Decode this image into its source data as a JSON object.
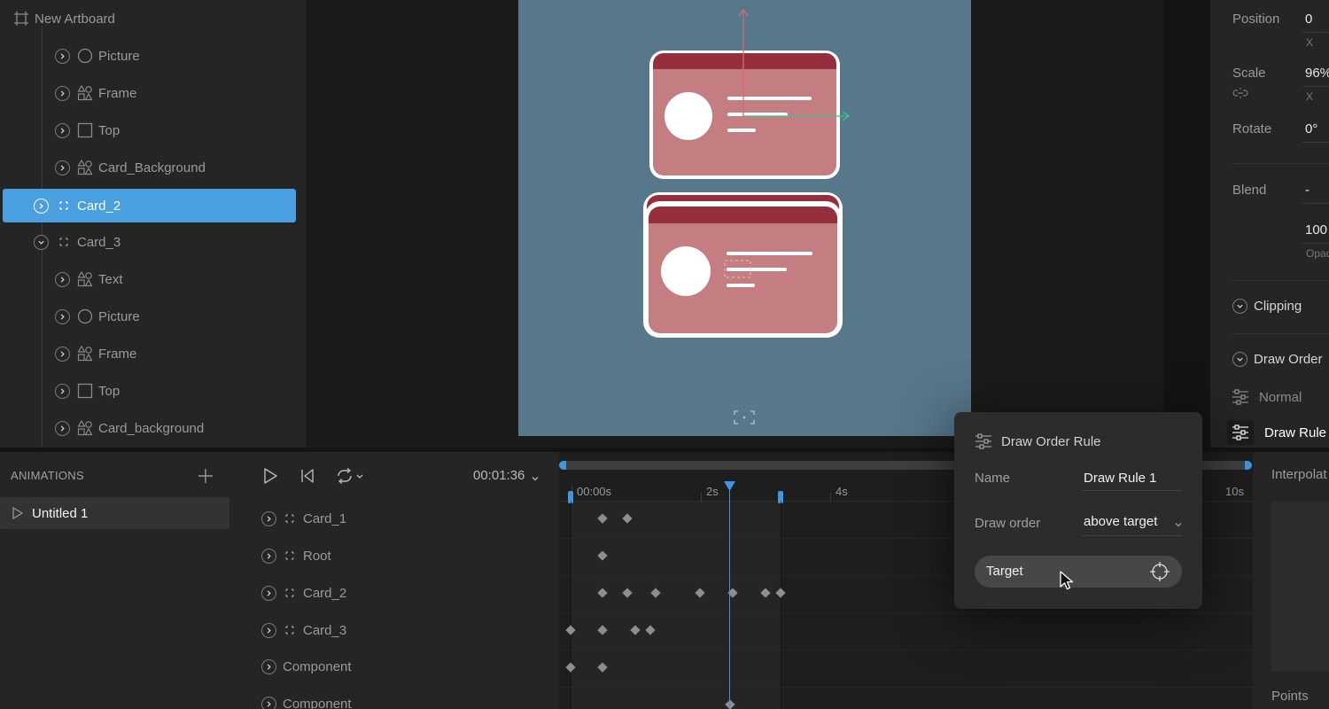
{
  "hierarchy": {
    "artboard_label": "New Artboard",
    "items": [
      {
        "label": "Picture",
        "icon": "ellipse-icon"
      },
      {
        "label": "Frame",
        "icon": "shapes-icon"
      },
      {
        "label": "Top",
        "icon": "rectangle-icon"
      },
      {
        "label": "Card_Background",
        "icon": "shapes-icon"
      },
      {
        "label": "Card_2",
        "icon": "group-icon",
        "selected": true
      },
      {
        "label": "Card_3",
        "icon": "group-icon",
        "expanded": true
      },
      {
        "label": "Text",
        "icon": "shapes-icon"
      },
      {
        "label": "Picture",
        "icon": "ellipse-icon"
      },
      {
        "label": "Frame",
        "icon": "shapes-icon"
      },
      {
        "label": "Top",
        "icon": "rectangle-icon"
      },
      {
        "label": "Card_background",
        "icon": "shapes-icon"
      }
    ]
  },
  "inspector": {
    "position_label": "Position",
    "position_value": "0",
    "position_sub": "X",
    "scale_label": "Scale",
    "scale_value": "96%",
    "scale_sub": "X",
    "rotate_label": "Rotate",
    "rotate_value": "0°",
    "blend_label": "Blend",
    "blend_value": "-",
    "opacity_value": "100",
    "opacity_sub": "Opac",
    "clipping_label": "Clipping",
    "draw_order_label": "Draw Order",
    "normal_label": "Normal",
    "draw_rule_label": "Draw Rule"
  },
  "animations": {
    "header": "ANIMATIONS",
    "items": [
      {
        "label": "Untitled 1"
      }
    ]
  },
  "timeline": {
    "current_time": "00:01:36",
    "ticks": [
      "00:00s",
      "2s",
      "4s",
      "10s"
    ],
    "layers": [
      {
        "label": "Card_1",
        "icon": "group-icon"
      },
      {
        "label": "Root",
        "icon": "group-icon"
      },
      {
        "label": "Card_2",
        "icon": "group-icon"
      },
      {
        "label": "Card_3",
        "icon": "group-icon"
      },
      {
        "label": "Component",
        "icon": ""
      },
      {
        "label": "Component",
        "icon": ""
      }
    ]
  },
  "interpolation": {
    "header": "Interpolat",
    "footer": "Points"
  },
  "popup": {
    "title": "Draw Order Rule",
    "name_label": "Name",
    "name_value": "Draw Rule 1",
    "order_label": "Draw order",
    "order_value": "above target",
    "target_label": "Target"
  },
  "colors": {
    "selection": "#4a9fe0",
    "artboard": "#57778a",
    "card_header": "#962f3d",
    "card_body": "#c47d80",
    "x_axis": "#35c48f",
    "y_axis": "#d46a78"
  }
}
